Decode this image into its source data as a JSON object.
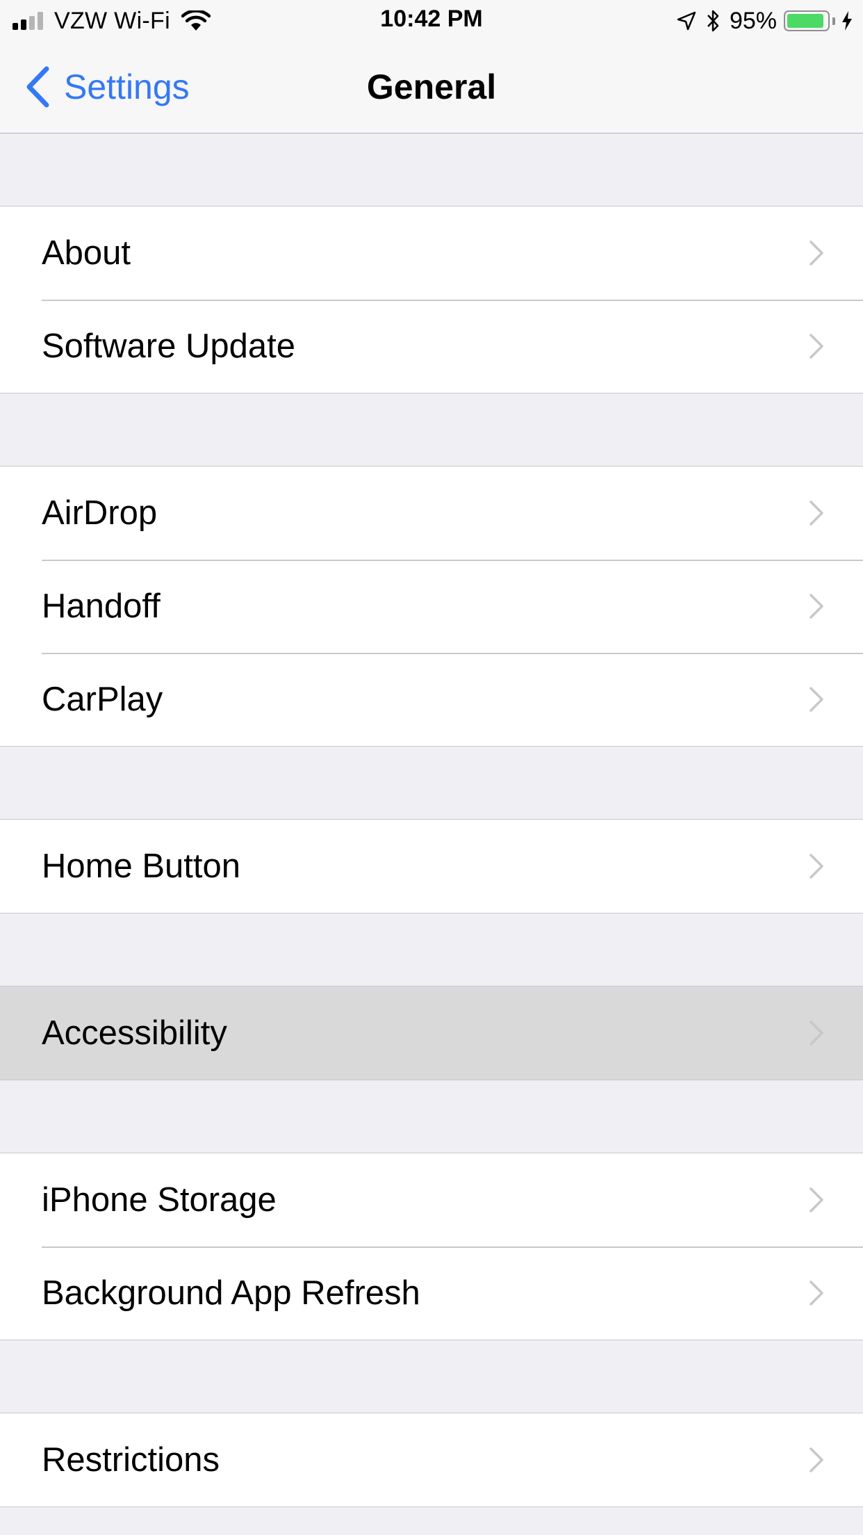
{
  "status_bar": {
    "carrier": "VZW Wi-Fi",
    "time": "10:42 PM",
    "battery_percent": "95%",
    "battery_level": 0.95,
    "battery_color": "#4cd964",
    "signal_bars_filled": 2,
    "icons": [
      "cellular-signal-icon",
      "wifi-icon",
      "location-arrow-icon",
      "bluetooth-icon",
      "battery-icon",
      "charging-bolt-icon"
    ]
  },
  "navbar": {
    "back_label": "Settings",
    "title": "General",
    "accent_color": "#3478f6"
  },
  "groups": [
    [
      {
        "label": "About",
        "selected": false
      },
      {
        "label": "Software Update",
        "selected": false
      }
    ],
    [
      {
        "label": "AirDrop",
        "selected": false
      },
      {
        "label": "Handoff",
        "selected": false
      },
      {
        "label": "CarPlay",
        "selected": false
      }
    ],
    [
      {
        "label": "Home Button",
        "selected": false
      }
    ],
    [
      {
        "label": "Accessibility",
        "selected": true
      }
    ],
    [
      {
        "label": "iPhone Storage",
        "selected": false
      },
      {
        "label": "Background App Refresh",
        "selected": false
      }
    ],
    [
      {
        "label": "Restrictions",
        "selected": false
      }
    ]
  ]
}
